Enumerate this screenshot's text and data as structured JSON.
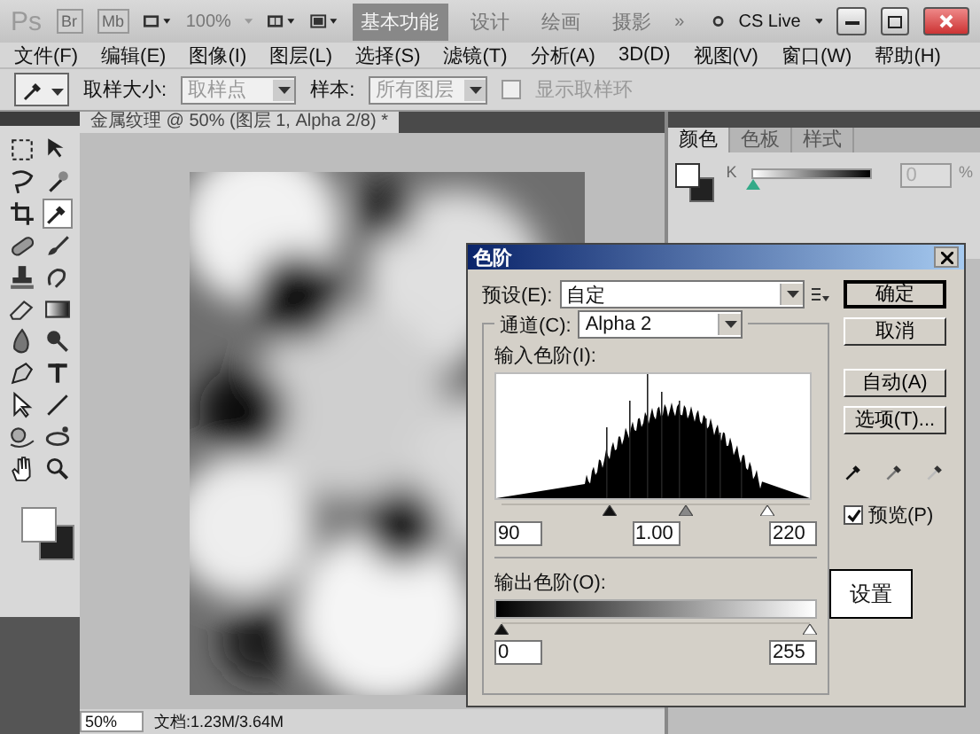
{
  "app_bar": {
    "logo": "Ps",
    "bridge": "Br",
    "mini_bridge": "Mb",
    "zoom": "100%",
    "workspaces": [
      {
        "label": "基本功能",
        "selected": true
      },
      {
        "label": "设计",
        "selected": false
      },
      {
        "label": "绘画",
        "selected": false
      },
      {
        "label": "摄影",
        "selected": false
      }
    ],
    "more": "»",
    "cs_live": "CS Live"
  },
  "menu": [
    "文件(F)",
    "编辑(E)",
    "图像(I)",
    "图层(L)",
    "选择(S)",
    "滤镜(T)",
    "分析(A)",
    "3D(D)",
    "视图(V)",
    "窗口(W)",
    "帮助(H)"
  ],
  "options_bar": {
    "sample_size_label": "取样大小:",
    "sample_size": "取样点",
    "sample_label": "样本:",
    "sample": "所有图层",
    "show_ring": {
      "label": "显示取样环",
      "checked": false,
      "disabled": true
    }
  },
  "tools": [
    {
      "kind": "marquee",
      "selected": false
    },
    {
      "kind": "move",
      "selected": false
    },
    {
      "kind": "lasso",
      "selected": false
    },
    {
      "kind": "wand",
      "selected": false
    },
    {
      "kind": "crop",
      "selected": false
    },
    {
      "kind": "eyedropper",
      "selected": true
    },
    {
      "kind": "healing",
      "selected": false
    },
    {
      "kind": "brush",
      "selected": false
    },
    {
      "kind": "stamp",
      "selected": false
    },
    {
      "kind": "history",
      "selected": false
    },
    {
      "kind": "eraser",
      "selected": false
    },
    {
      "kind": "gradient",
      "selected": false
    },
    {
      "kind": "blur",
      "selected": false
    },
    {
      "kind": "dodge",
      "selected": false
    },
    {
      "kind": "pen",
      "selected": false
    },
    {
      "kind": "type",
      "selected": false
    },
    {
      "kind": "select",
      "selected": false
    },
    {
      "kind": "line",
      "selected": false
    },
    {
      "kind": "rotate3d",
      "selected": false
    },
    {
      "kind": "orbit3d",
      "selected": false
    },
    {
      "kind": "hand",
      "selected": false
    },
    {
      "kind": "zoom",
      "selected": false
    }
  ],
  "document": {
    "tab": "金属纹理 @ 50% (图层 1, Alpha 2/8) *",
    "zoom": "50%",
    "doc_size": "文档:1.23M/3.64M"
  },
  "color_panel": {
    "tabs": [
      {
        "label": "颜色",
        "selected": true
      },
      {
        "label": "色板",
        "selected": false
      },
      {
        "label": "样式",
        "selected": false
      }
    ],
    "channel": "K",
    "level": 0,
    "value": "0",
    "unit": "%"
  },
  "levels_dialog": {
    "title": "色阶",
    "preset_label": "预设(E):",
    "preset": "自定",
    "channel_label": "通道(C):",
    "channel": "Alpha 2",
    "input_label": "输入色阶(I):",
    "input_sliders": [
      {
        "kind": "black",
        "level": 0.35
      },
      {
        "kind": "gray",
        "level": 0.6
      },
      {
        "kind": "white",
        "level": 0.86
      }
    ],
    "input_values": [
      "90",
      "1.00",
      "220"
    ],
    "output_label": "输出色阶(O):",
    "output_sliders": [
      {
        "kind": "black",
        "level": 0
      },
      {
        "kind": "white",
        "level": 1
      }
    ],
    "output_values": [
      "0",
      "255"
    ],
    "buttons": [
      {
        "label": "确定",
        "default": true
      },
      {
        "label": "取消",
        "default": false
      },
      {
        "label": "自动(A)",
        "default": false
      },
      {
        "label": "选项(T)...",
        "default": false
      }
    ],
    "preview": {
      "label": "预览(P)",
      "checked": true
    }
  },
  "annotation": "设置"
}
